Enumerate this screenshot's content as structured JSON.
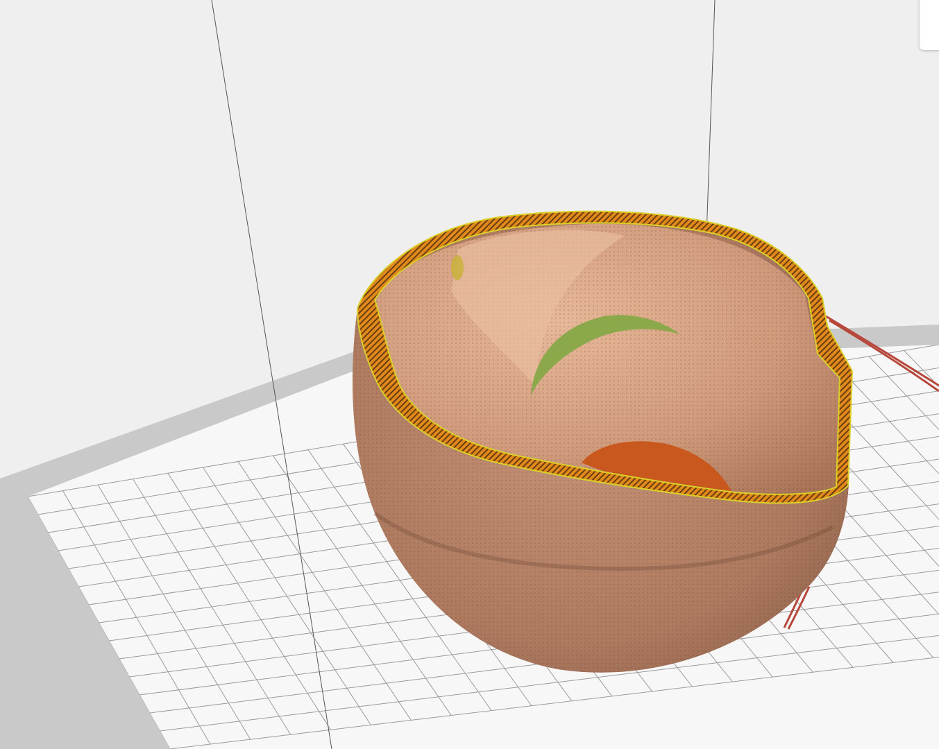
{
  "viewport": {
    "background_color": "#efefef",
    "wall_line_color": "#555555"
  },
  "build_plate": {
    "plate_color": "#f7f7f7",
    "border_color": "#c9c9c9",
    "grid_color": "#9a9a9a"
  },
  "model": {
    "shell_color": "#b8856a",
    "inner_color": "#dcaa8c",
    "rim_fill_color": "#e08a1c",
    "rim_outline_color": "#d9d02a",
    "infill_color": "#8ba84a",
    "top_skin_color": "#c9581e",
    "support_color": "#b8473b"
  },
  "corner_panel": {
    "icon": "panel-tab-icon"
  }
}
